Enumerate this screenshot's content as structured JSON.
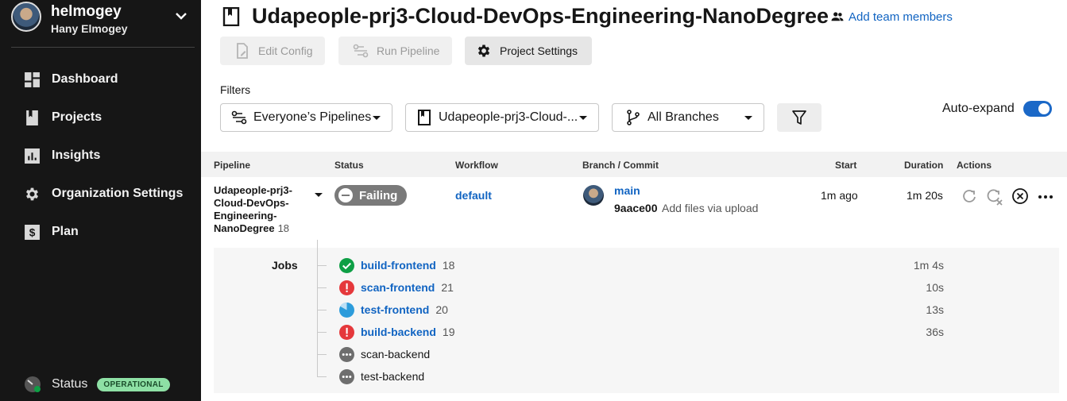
{
  "sidebar": {
    "username": "helmogey",
    "fullname": "Hany Elmogey",
    "items": [
      {
        "label": "Dashboard",
        "icon": "dashboard-icon"
      },
      {
        "label": "Projects",
        "icon": "projects-icon"
      },
      {
        "label": "Insights",
        "icon": "insights-icon"
      },
      {
        "label": "Organization Settings",
        "icon": "gear-icon"
      },
      {
        "label": "Plan",
        "icon": "dollar-icon"
      }
    ],
    "status_label": "Status",
    "status_badge": "OPERATIONAL"
  },
  "header": {
    "title": "Udapeople-prj3-Cloud-DevOps-Engineering-NanoDegree",
    "add_team": "Add team members",
    "buttons": {
      "edit_config": "Edit Config",
      "run_pipeline": "Run Pipeline",
      "project_settings": "Project Settings"
    }
  },
  "filters": {
    "label": "Filters",
    "pipelines": "Everyone’s Pipelines",
    "project": "Udapeople-prj3-Cloud-...",
    "branches": "All Branches",
    "autoexpand": "Auto-expand"
  },
  "table": {
    "headers": {
      "pipeline": "Pipeline",
      "status": "Status",
      "workflow": "Workflow",
      "branch_commit": "Branch / Commit",
      "start": "Start",
      "duration": "Duration",
      "actions": "Actions"
    },
    "row": {
      "pipeline_name": "Udapeople-prj3-Cloud-DevOps-Engineering-NanoDegree",
      "pipeline_number": "18",
      "status": "Failing",
      "workflow": "default",
      "branch": "main",
      "commit_hash": "9aace00",
      "commit_message": "Add files via upload",
      "start": "1m ago",
      "duration": "1m 20s"
    },
    "jobs_label": "Jobs",
    "jobs": [
      {
        "name": "build-frontend",
        "number": "18",
        "duration": "1m 4s",
        "state": "success"
      },
      {
        "name": "scan-frontend",
        "number": "21",
        "duration": "10s",
        "state": "failed"
      },
      {
        "name": "test-frontend",
        "number": "20",
        "duration": "13s",
        "state": "running"
      },
      {
        "name": "build-backend",
        "number": "19",
        "duration": "36s",
        "state": "failed"
      },
      {
        "name": "scan-backend",
        "number": "",
        "duration": "",
        "state": "blocked"
      },
      {
        "name": "test-backend",
        "number": "",
        "duration": "",
        "state": "blocked"
      }
    ]
  },
  "colors": {
    "accent": "#1164c2",
    "success": "#0e9f45",
    "failed": "#e5383b",
    "running": "#2d9cdb",
    "blocked": "#6e6e6e",
    "sidebar_bg": "#161616"
  }
}
